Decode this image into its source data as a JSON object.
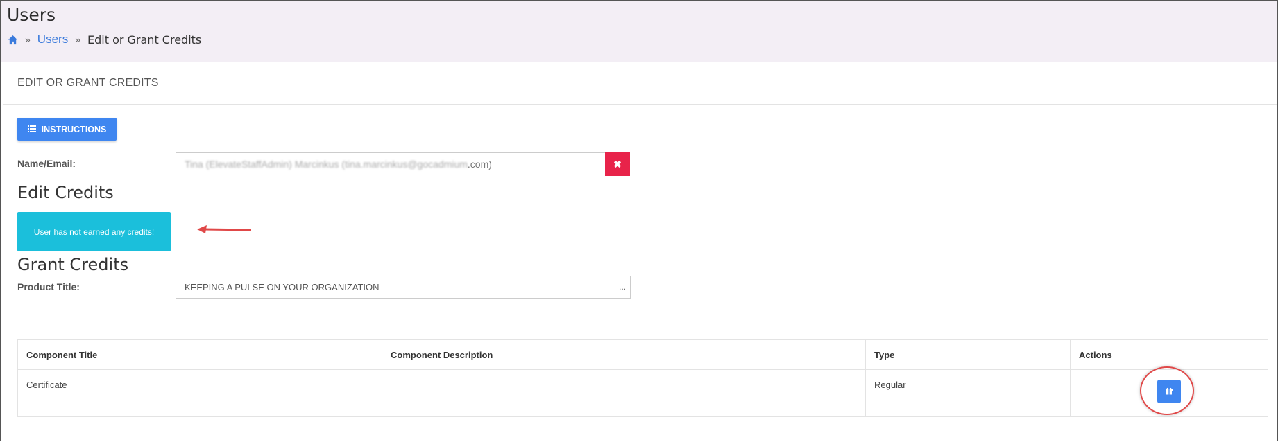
{
  "header": {
    "title": "Users",
    "breadcrumb": {
      "users_link": "Users",
      "current": "Edit or Grant Credits",
      "separator": "»"
    }
  },
  "card": {
    "title": "EDIT OR GRANT CREDITS",
    "instructions_button": "INSTRUCTIONS",
    "name_email": {
      "label": "Name/Email:",
      "value_blurred": "Tina (ElevateStaffAdmin) Marcinkus (tina.marcinkus@gocadmium",
      "value_suffix": ".com)"
    },
    "edit_credits": {
      "heading": "Edit Credits",
      "alert": "User has not earned any credits!"
    },
    "grant_credits": {
      "heading": "Grant Credits",
      "product_label": "Product Title:",
      "product_value": "KEEPING A PULSE ON YOUR ORGANIZATION",
      "product_more": "..."
    },
    "table": {
      "headers": [
        "Component Title",
        "Component Description",
        "Type",
        "Actions"
      ],
      "rows": [
        {
          "title": "Certificate",
          "description": "",
          "type": "Regular"
        }
      ]
    }
  },
  "colors": {
    "primary": "#3f86f0",
    "danger": "#e8234a",
    "info": "#1bbfdb",
    "header_bg": "#f3eef5",
    "annotation": "#e04848"
  },
  "icons": {
    "home": "home-icon",
    "instructions": "list-icon",
    "clear": "close-icon",
    "grant": "gift-icon"
  }
}
